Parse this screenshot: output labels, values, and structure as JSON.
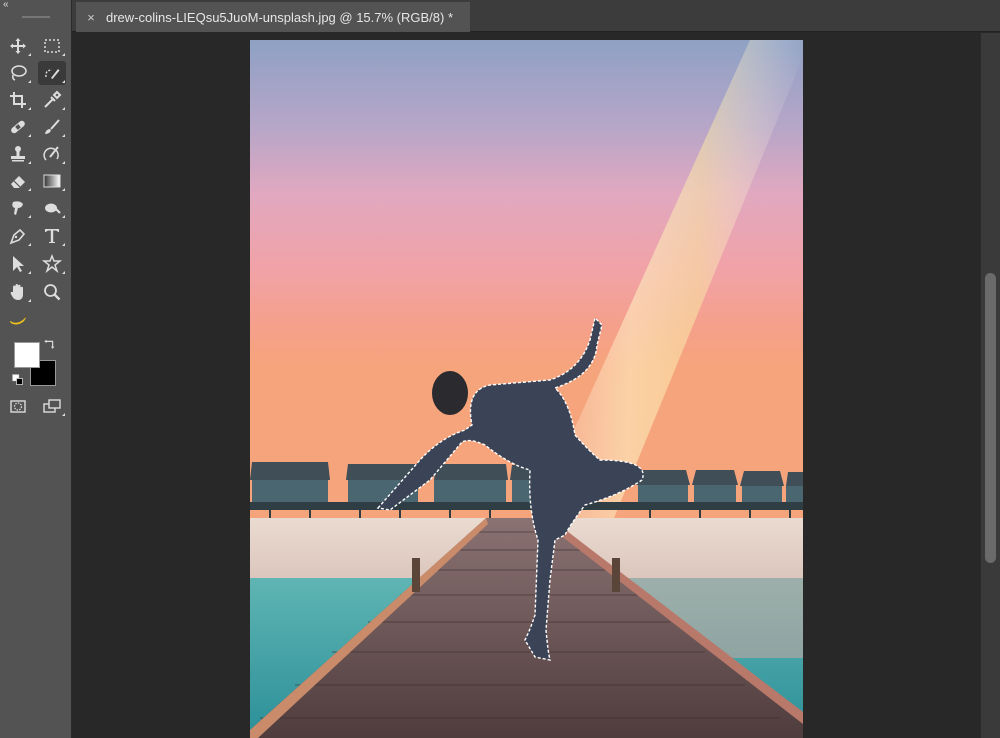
{
  "tab": {
    "close_symbol": "×",
    "title": "drew-colins-LIEQsu5JuoM-unsplash.jpg @ 15.7% (RGB/8) *"
  },
  "toolbar": {
    "collapse_symbol": "«",
    "tools": [
      {
        "name": "move-tool",
        "icon": "move-icon"
      },
      {
        "name": "rectangular-marquee-tool",
        "icon": "marquee-icon"
      },
      {
        "name": "lasso-tool",
        "icon": "lasso-icon"
      },
      {
        "name": "quick-selection-tool",
        "icon": "quick-selection-icon",
        "active": true
      },
      {
        "name": "crop-tool",
        "icon": "crop-icon"
      },
      {
        "name": "eyedropper-tool",
        "icon": "eyedropper-icon"
      },
      {
        "name": "healing-brush-tool",
        "icon": "bandage-icon"
      },
      {
        "name": "brush-tool",
        "icon": "brush-icon"
      },
      {
        "name": "clone-stamp-tool",
        "icon": "stamp-icon"
      },
      {
        "name": "history-brush-tool",
        "icon": "history-brush-icon"
      },
      {
        "name": "eraser-tool",
        "icon": "eraser-icon"
      },
      {
        "name": "gradient-tool",
        "icon": "gradient-icon"
      },
      {
        "name": "smudge-tool",
        "icon": "smudge-icon"
      },
      {
        "name": "dodge-tool",
        "icon": "dodge-icon"
      },
      {
        "name": "pen-tool",
        "icon": "pen-icon"
      },
      {
        "name": "type-tool",
        "icon": "type-icon",
        "label": "T"
      },
      {
        "name": "path-selection-tool",
        "icon": "arrow-icon"
      },
      {
        "name": "custom-shape-tool",
        "icon": "shape-icon"
      },
      {
        "name": "hand-tool",
        "icon": "hand-icon"
      },
      {
        "name": "zoom-tool",
        "icon": "zoom-icon"
      },
      {
        "name": "banana-tool",
        "icon": "banana-icon"
      }
    ],
    "foreground_color": "#ffffff",
    "background_color": "#000000"
  },
  "colors": {
    "toolbar_bg": "#535353",
    "workspace_bg": "#282828",
    "tab_bg": "#535353",
    "icon": "#dddddd",
    "banana": "#f2c21b"
  }
}
